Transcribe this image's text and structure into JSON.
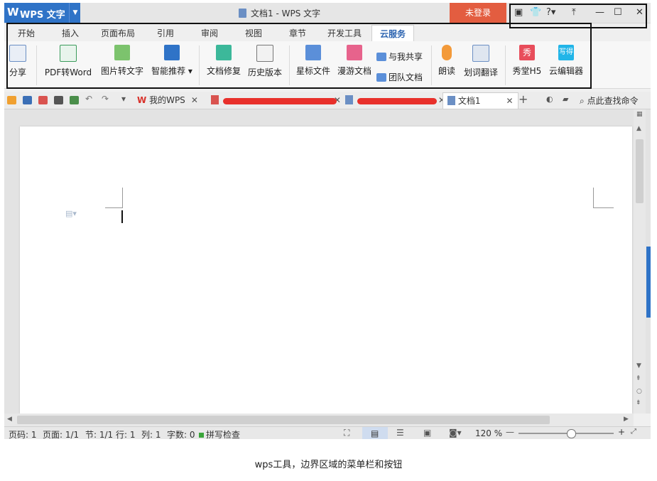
{
  "titlebar": {
    "app_name": "WPS 文字",
    "doc_title": "文档1 - WPS 文字",
    "login_label": "未登录"
  },
  "tabs": [
    "开始",
    "插入",
    "页面布局",
    "引用",
    "审阅",
    "视图",
    "章节",
    "开发工具",
    "云服务"
  ],
  "active_tab": "云服务",
  "ribbon": {
    "share": "分享",
    "pdf_to_word": "PDF转Word",
    "image_to_text": "图片转文字",
    "smart_recommend": "智能推荐",
    "doc_repair": "文档修复",
    "history": "历史版本",
    "starred": "星标文件",
    "roaming": "漫游文档",
    "shared_with_me": "与我共享",
    "team_docs": "团队文档",
    "read_aloud": "朗读",
    "translate": "划词翻译",
    "xiutang": "秀堂H5",
    "cloud_editor": "云编辑器",
    "xiu_icon_text": "秀",
    "xie_icon_text": "写得"
  },
  "doc_tabs": {
    "my_wps": "我的WPS",
    "doc1": "文档1",
    "search_cmd": "点此查找命令"
  },
  "status": {
    "page": "页码: 1",
    "pages": "页面: 1/1",
    "section": "节: 1/1",
    "row": "行: 1",
    "col": "列: 1",
    "words": "字数: 0",
    "spell": "拼写检查",
    "zoom": "120 %"
  },
  "zoom_level": 0.55,
  "caption": "wps工具，边界区域的菜单栏和按钮",
  "colors": {
    "brand_blue": "#2f73c7",
    "login_red": "#e35d40",
    "redaction_red": "#e8302b"
  }
}
